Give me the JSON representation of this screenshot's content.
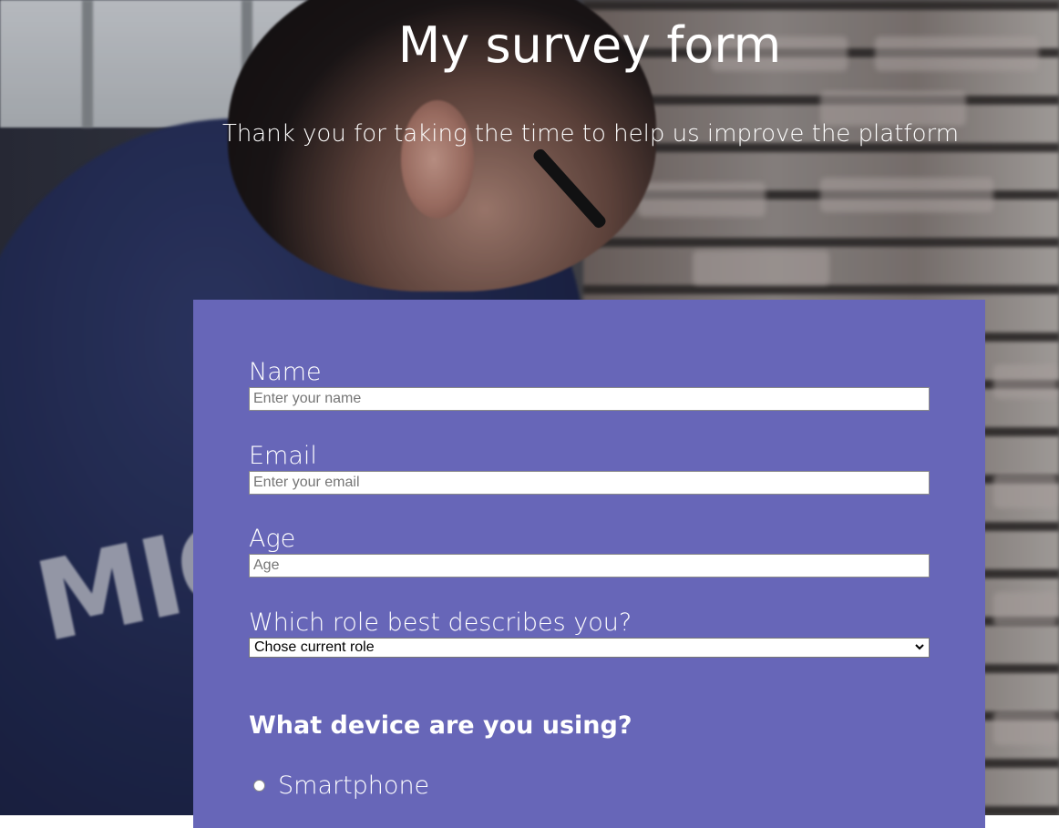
{
  "header": {
    "title": "My survey form",
    "subtitle": "Thank you for taking the time to help us improve the platform"
  },
  "form": {
    "name": {
      "label": "Name",
      "placeholder": "Enter your name",
      "value": ""
    },
    "email": {
      "label": "Email",
      "placeholder": "Enter your email",
      "value": ""
    },
    "age": {
      "label": "Age",
      "placeholder": "Age",
      "value": ""
    },
    "role": {
      "label": "Which role best describes you?",
      "selected": "Chose current role"
    },
    "device": {
      "heading": "What device are you using?",
      "options": [
        {
          "label": "Smartphone",
          "checked": false
        }
      ]
    }
  },
  "colors": {
    "form_panel": "#6766b8",
    "text": "#ffffff"
  },
  "background": {
    "shirt_text": "MIC"
  }
}
